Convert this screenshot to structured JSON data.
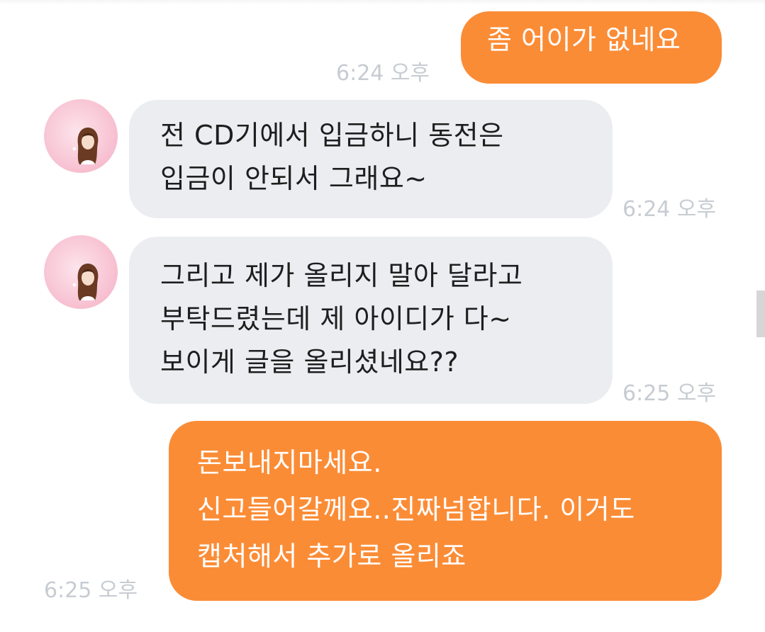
{
  "messages": [
    {
      "direction": "sent",
      "lines": [
        "좀 어이가 없네요"
      ],
      "time": "6:24 오후"
    },
    {
      "direction": "received",
      "avatar_icon": "profile-avatar-icon",
      "lines": [
        "전 CD기에서 입금하니 동전은",
        "입금이 안되서 그래요~"
      ],
      "time": "6:24 오후"
    },
    {
      "direction": "received",
      "avatar_icon": "profile-avatar-icon",
      "lines": [
        "그리고 제가 올리지 말아 달라고",
        "부탁드렸는데 제 아이디가 다~",
        "보이게 글을 올리셨네요??"
      ],
      "time": "6:25 오후"
    },
    {
      "direction": "sent",
      "lines": [
        "돈보내지마세요.",
        "신고들어갈께요..진짜넘합니다. 이거도",
        "캡처해서 추가로 올리죠"
      ],
      "time": "6:25 오후"
    }
  ],
  "colors": {
    "sent_bubble": "#fb8c36",
    "received_bubble": "#ebedf0",
    "timestamp": "#c7ccd2"
  }
}
